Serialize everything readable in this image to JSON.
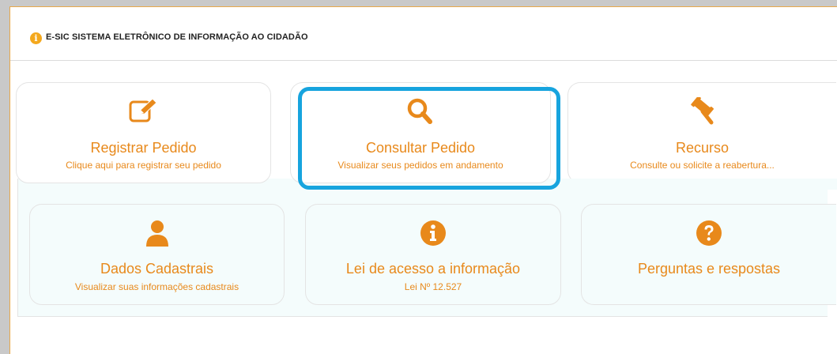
{
  "header": {
    "title": "E-SIC SISTEMA ELETRÔNICO DE INFORMAÇÃO AO CIDADÃO",
    "icon": "info-icon"
  },
  "colors": {
    "accent": "#e8891b",
    "highlight": "#17a4de",
    "panel_bg": "#f4fcfc"
  },
  "cards": [
    {
      "icon": "edit-icon",
      "title": "Registrar Pedido",
      "subtitle": "Clique aqui para registrar seu pedido"
    },
    {
      "icon": "search-icon",
      "title": "Consultar Pedido",
      "subtitle": "Visualizar seus pedidos em andamento"
    },
    {
      "icon": "gavel-icon",
      "title": "Recurso",
      "subtitle": "Consulte ou solicite a reabertura..."
    },
    {
      "icon": "user-icon",
      "title": "Dados Cadastrais",
      "subtitle": "Visualizar suas informações cadastrais"
    },
    {
      "icon": "info-circle-icon",
      "title": "Lei de acesso a informação",
      "subtitle": "Lei Nº 12.527"
    },
    {
      "icon": "question-circle-icon",
      "title": "Perguntas e respostas",
      "subtitle": ""
    }
  ]
}
